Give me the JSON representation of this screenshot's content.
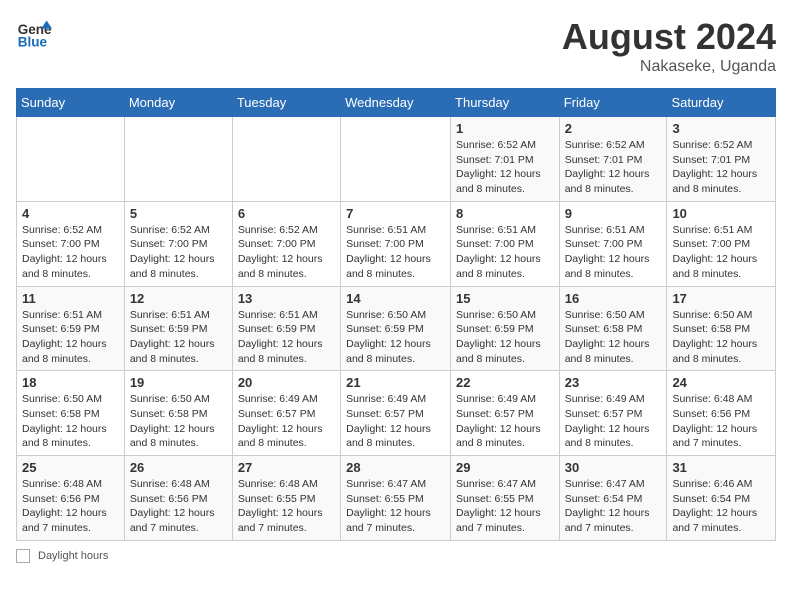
{
  "header": {
    "logo_general": "General",
    "logo_blue": "Blue",
    "month_year": "August 2024",
    "location": "Nakaseke, Uganda"
  },
  "days_of_week": [
    "Sunday",
    "Monday",
    "Tuesday",
    "Wednesday",
    "Thursday",
    "Friday",
    "Saturday"
  ],
  "weeks": [
    [
      {
        "day": "",
        "info": ""
      },
      {
        "day": "",
        "info": ""
      },
      {
        "day": "",
        "info": ""
      },
      {
        "day": "",
        "info": ""
      },
      {
        "day": "1",
        "info": "Sunrise: 6:52 AM\nSunset: 7:01 PM\nDaylight: 12 hours and 8 minutes."
      },
      {
        "day": "2",
        "info": "Sunrise: 6:52 AM\nSunset: 7:01 PM\nDaylight: 12 hours and 8 minutes."
      },
      {
        "day": "3",
        "info": "Sunrise: 6:52 AM\nSunset: 7:01 PM\nDaylight: 12 hours and 8 minutes."
      }
    ],
    [
      {
        "day": "4",
        "info": "Sunrise: 6:52 AM\nSunset: 7:00 PM\nDaylight: 12 hours and 8 minutes."
      },
      {
        "day": "5",
        "info": "Sunrise: 6:52 AM\nSunset: 7:00 PM\nDaylight: 12 hours and 8 minutes."
      },
      {
        "day": "6",
        "info": "Sunrise: 6:52 AM\nSunset: 7:00 PM\nDaylight: 12 hours and 8 minutes."
      },
      {
        "day": "7",
        "info": "Sunrise: 6:51 AM\nSunset: 7:00 PM\nDaylight: 12 hours and 8 minutes."
      },
      {
        "day": "8",
        "info": "Sunrise: 6:51 AM\nSunset: 7:00 PM\nDaylight: 12 hours and 8 minutes."
      },
      {
        "day": "9",
        "info": "Sunrise: 6:51 AM\nSunset: 7:00 PM\nDaylight: 12 hours and 8 minutes."
      },
      {
        "day": "10",
        "info": "Sunrise: 6:51 AM\nSunset: 7:00 PM\nDaylight: 12 hours and 8 minutes."
      }
    ],
    [
      {
        "day": "11",
        "info": "Sunrise: 6:51 AM\nSunset: 6:59 PM\nDaylight: 12 hours and 8 minutes."
      },
      {
        "day": "12",
        "info": "Sunrise: 6:51 AM\nSunset: 6:59 PM\nDaylight: 12 hours and 8 minutes."
      },
      {
        "day": "13",
        "info": "Sunrise: 6:51 AM\nSunset: 6:59 PM\nDaylight: 12 hours and 8 minutes."
      },
      {
        "day": "14",
        "info": "Sunrise: 6:50 AM\nSunset: 6:59 PM\nDaylight: 12 hours and 8 minutes."
      },
      {
        "day": "15",
        "info": "Sunrise: 6:50 AM\nSunset: 6:59 PM\nDaylight: 12 hours and 8 minutes."
      },
      {
        "day": "16",
        "info": "Sunrise: 6:50 AM\nSunset: 6:58 PM\nDaylight: 12 hours and 8 minutes."
      },
      {
        "day": "17",
        "info": "Sunrise: 6:50 AM\nSunset: 6:58 PM\nDaylight: 12 hours and 8 minutes."
      }
    ],
    [
      {
        "day": "18",
        "info": "Sunrise: 6:50 AM\nSunset: 6:58 PM\nDaylight: 12 hours and 8 minutes."
      },
      {
        "day": "19",
        "info": "Sunrise: 6:50 AM\nSunset: 6:58 PM\nDaylight: 12 hours and 8 minutes."
      },
      {
        "day": "20",
        "info": "Sunrise: 6:49 AM\nSunset: 6:57 PM\nDaylight: 12 hours and 8 minutes."
      },
      {
        "day": "21",
        "info": "Sunrise: 6:49 AM\nSunset: 6:57 PM\nDaylight: 12 hours and 8 minutes."
      },
      {
        "day": "22",
        "info": "Sunrise: 6:49 AM\nSunset: 6:57 PM\nDaylight: 12 hours and 8 minutes."
      },
      {
        "day": "23",
        "info": "Sunrise: 6:49 AM\nSunset: 6:57 PM\nDaylight: 12 hours and 8 minutes."
      },
      {
        "day": "24",
        "info": "Sunrise: 6:48 AM\nSunset: 6:56 PM\nDaylight: 12 hours and 7 minutes."
      }
    ],
    [
      {
        "day": "25",
        "info": "Sunrise: 6:48 AM\nSunset: 6:56 PM\nDaylight: 12 hours and 7 minutes."
      },
      {
        "day": "26",
        "info": "Sunrise: 6:48 AM\nSunset: 6:56 PM\nDaylight: 12 hours and 7 minutes."
      },
      {
        "day": "27",
        "info": "Sunrise: 6:48 AM\nSunset: 6:55 PM\nDaylight: 12 hours and 7 minutes."
      },
      {
        "day": "28",
        "info": "Sunrise: 6:47 AM\nSunset: 6:55 PM\nDaylight: 12 hours and 7 minutes."
      },
      {
        "day": "29",
        "info": "Sunrise: 6:47 AM\nSunset: 6:55 PM\nDaylight: 12 hours and 7 minutes."
      },
      {
        "day": "30",
        "info": "Sunrise: 6:47 AM\nSunset: 6:54 PM\nDaylight: 12 hours and 7 minutes."
      },
      {
        "day": "31",
        "info": "Sunrise: 6:46 AM\nSunset: 6:54 PM\nDaylight: 12 hours and 7 minutes."
      }
    ]
  ],
  "footer": {
    "label": "Daylight hours"
  }
}
